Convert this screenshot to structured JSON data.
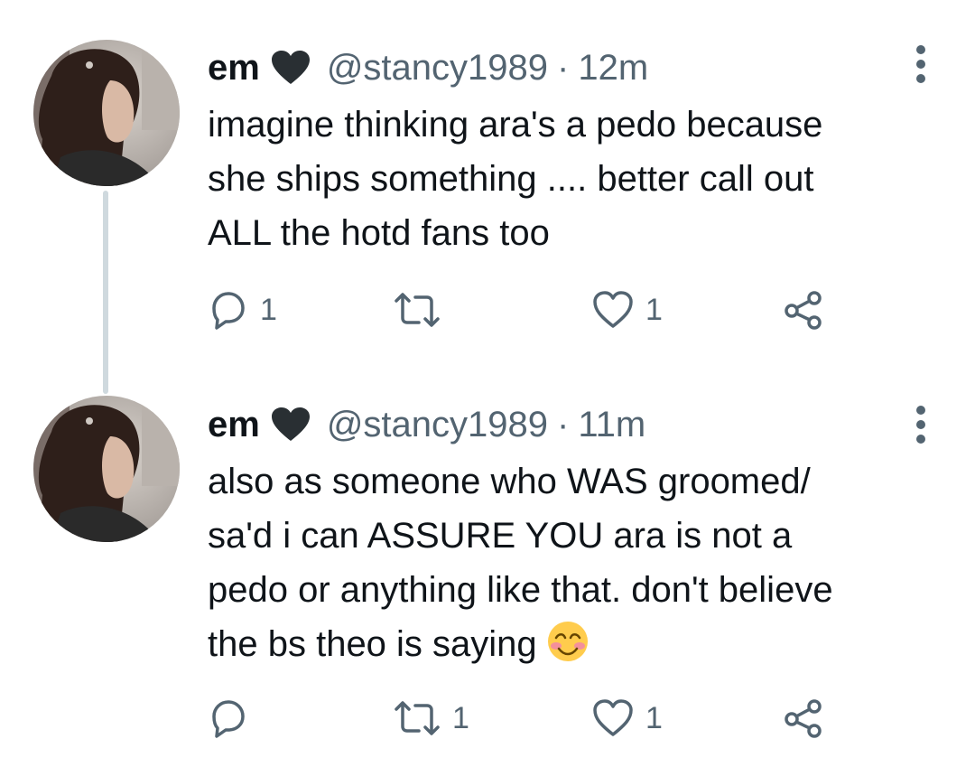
{
  "tweets": [
    {
      "display_name": "em",
      "handle": "@stancy1989",
      "separator": "·",
      "time": "12m",
      "text": "imagine thinking ara's a pedo because\nshe ships something .... better call out\nALL the hotd fans too",
      "replies": "1",
      "retweets": "",
      "likes": "1",
      "has_emoji": false
    },
    {
      "display_name": "em",
      "handle": "@stancy1989",
      "separator": "·",
      "time": "11m",
      "text": "also as someone who WAS groomed/\nsa'd i can ASSURE YOU ara is not a\npedo or anything like that. don't believe\nthe bs theo is saying",
      "emoji": "smiling-face-with-blush-emoji",
      "replies": "",
      "retweets": "1",
      "likes": "1",
      "has_emoji": true
    }
  ],
  "icons": {
    "badge": "black-heart-icon",
    "more": "more-vertical-icon",
    "reply": "reply-icon",
    "retweet": "retweet-icon",
    "like": "like-heart-icon",
    "share": "share-icon"
  },
  "colors": {
    "text": "#0f1419",
    "secondary": "#536471",
    "thread_line": "#cfd9de",
    "icon_stroke": "#536471"
  }
}
